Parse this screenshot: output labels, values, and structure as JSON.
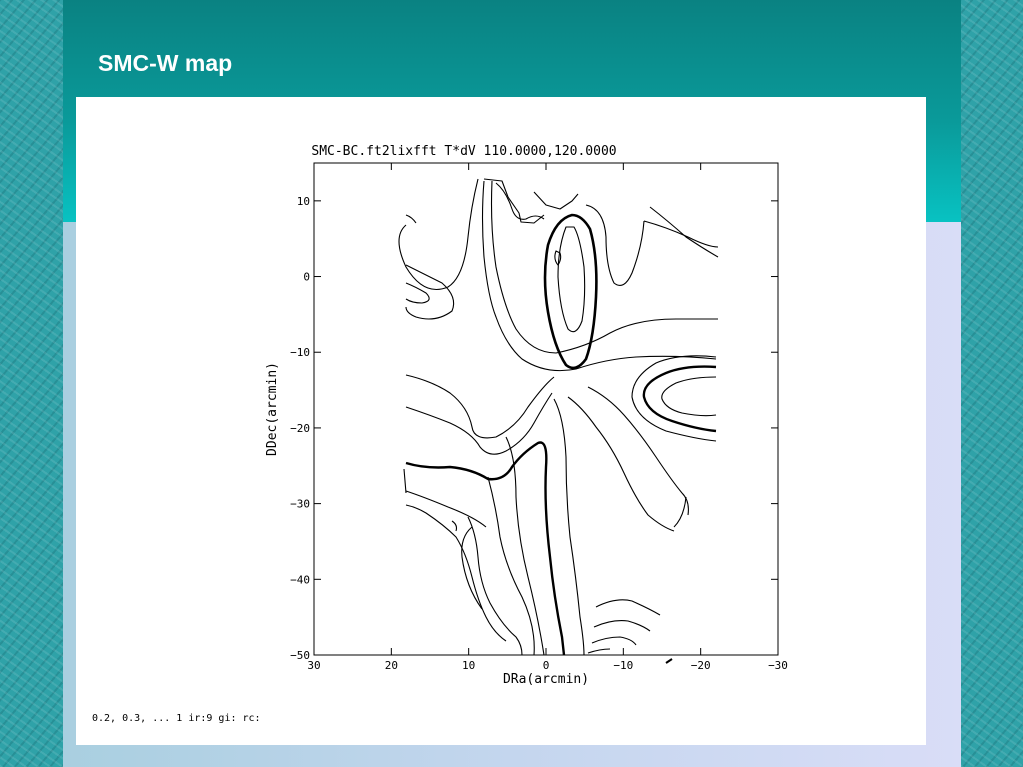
{
  "slide": {
    "title": "SMC-W map"
  },
  "chart_data": {
    "type": "contour",
    "title": "SMC-BC.ft2lixfft   T*dV 110.0000,120.0000",
    "xlabel": "DRa(arcmin)",
    "ylabel": "DDec(arcmin)",
    "xlim": [
      30,
      -30
    ],
    "ylim": [
      -50,
      15
    ],
    "x_ticks": [
      30,
      20,
      10,
      0,
      -10,
      -20,
      -30
    ],
    "y_ticks": [
      10,
      0,
      -10,
      -20,
      -30,
      -40,
      -50
    ],
    "x_tick_labels": [
      "30",
      "20",
      "10",
      "0",
      "−10",
      "−20",
      "−30"
    ],
    "y_tick_labels": [
      "10",
      "0",
      "−10",
      "−20",
      "−30",
      "−40",
      "−50"
    ],
    "contour_levels_note": "0.2, 0.3, ... 1  ir:9 gi: rc:",
    "grid": false,
    "colors": {
      "line": "#000000",
      "background": "#ffffff",
      "header": "#0a8c8c"
    }
  }
}
